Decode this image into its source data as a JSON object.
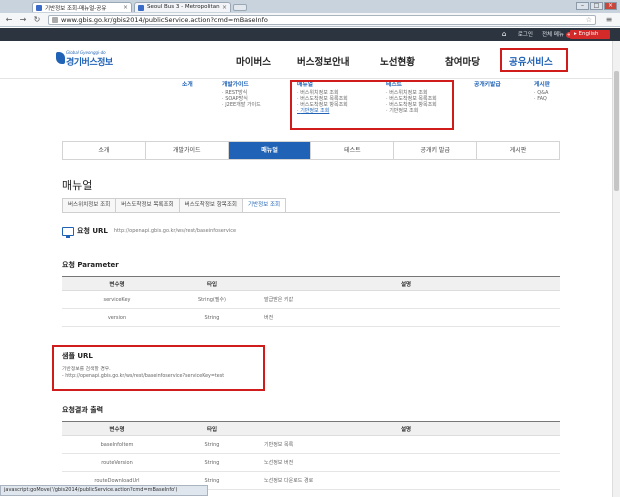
{
  "browser": {
    "tabs": [
      {
        "title": "기반정보 조회-매뉴얼-공유",
        "active": true
      },
      {
        "title": "Seoul Bus 3 - Metropolitan",
        "active": false
      }
    ],
    "url": "www.gbis.go.kr/gbis2014/publicService.action?cmd=mBaseInfo",
    "status_url": "javascript:goMove('/gbis2014/publicService.action?cmd=mBaseInfo')"
  },
  "util_bar": {
    "items": [
      "로그인",
      "전체 메뉴"
    ],
    "badge": "+",
    "english": "English"
  },
  "header": {
    "logo_small": "Global Gyeonggi-do",
    "logo_main": "경기버스정보",
    "gnb": [
      "마이버스",
      "버스정보안내",
      "노선현황",
      "참여마당",
      "공유서비스"
    ]
  },
  "mega_menu": {
    "intro": {
      "head": "소개"
    },
    "devguide": {
      "head": "개발가이드",
      "items": [
        "REST방식",
        "SOAP방식",
        "J2EE개발 가이드"
      ]
    },
    "manual": {
      "head": "매뉴얼",
      "items": [
        "버스위치정보 조회",
        "버스도착정보 목록조회",
        "버스도착정보 항목조회",
        "기반정보 조회"
      ]
    },
    "test": {
      "head": "테스트",
      "items": [
        "버스위치정보 조회",
        "버스도착정보 목록조회",
        "버스도착정보 항목조회",
        "기반정보 조회"
      ]
    },
    "apikey": {
      "head": "공개키발급"
    },
    "board": {
      "head": "게시판",
      "items": [
        "Q&A",
        "FAQ"
      ]
    }
  },
  "tabbar": [
    "소개",
    "개발가이드",
    "매뉴얼",
    "테스트",
    "공개키 발급",
    "게시판"
  ],
  "page_title": "매뉴얼",
  "subtabs": [
    "버스위치정보 조회",
    "버스도착정보 목록조회",
    "버스도착정보 항목조회",
    "기반정보 조회"
  ],
  "request_url": {
    "label": "요청 URL",
    "value": "http://openapi.gbis.go.kr/ws/rest/baseinfoservice"
  },
  "request_params": {
    "title": "요청 Parameter",
    "headers": [
      "변수명",
      "타입",
      "설명"
    ],
    "rows": [
      [
        "serviceKey",
        "String(필수)",
        "발급받은 키값"
      ],
      [
        "version",
        "String",
        "버전"
      ]
    ]
  },
  "sample": {
    "title": "샘플 URL",
    "desc": "기반정보를 검색할 경우.",
    "url": "http://openapi.gbis.go.kr/ws/rest/baseinfoservice?serviceKey=test"
  },
  "response": {
    "title": "요청결과 출력",
    "headers": [
      "변수명",
      "타입",
      "설명"
    ],
    "rows": [
      [
        "baseInfoItem",
        "String",
        "기반정보 목록"
      ],
      [
        "routeVersion",
        "String",
        "노선정보 버전"
      ],
      [
        "routeDownloadUrl",
        "String",
        "노선정보 다운로드 경로"
      ]
    ]
  }
}
